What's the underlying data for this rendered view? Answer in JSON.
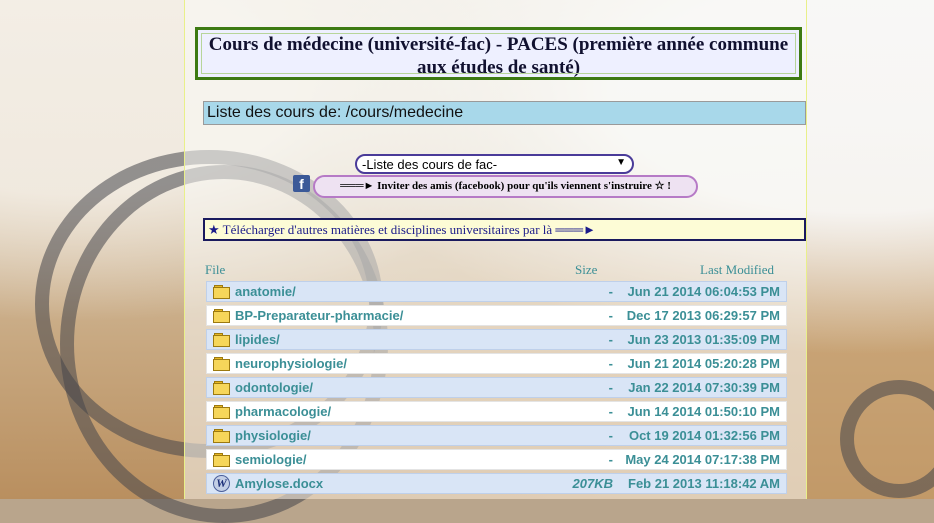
{
  "header": {
    "title": "Cours de médecine (université-fac) - PACES (première année commune aux études de santé)"
  },
  "listing": {
    "label": "Liste des cours de: /cours/medecine"
  },
  "course_select": {
    "selected": "-Liste des cours de fac-"
  },
  "invite": {
    "label": "═══► Inviter des amis (facebook) pour qu'ils viennent s'instruire ☆ !"
  },
  "download_bar": {
    "label": "★ Télécharger d'autres matières et disciplines universitaires par là ═══►"
  },
  "table": {
    "columns": {
      "file": "File",
      "size": "Size",
      "modified": "Last Modified"
    },
    "rows": [
      {
        "icon": "folder-icon",
        "name": "anatomie/",
        "size": "-",
        "modified": "Jun 21 2014 06:04:53 PM"
      },
      {
        "icon": "folder-icon",
        "name": "BP-Preparateur-pharmacie/",
        "size": "-",
        "modified": "Dec 17 2013 06:29:57 PM"
      },
      {
        "icon": "folder-icon",
        "name": "lipides/",
        "size": "-",
        "modified": "Jun 23 2013 01:35:09 PM"
      },
      {
        "icon": "folder-icon",
        "name": "neurophysiologie/",
        "size": "-",
        "modified": "Jun 21 2014 05:20:28 PM"
      },
      {
        "icon": "folder-icon",
        "name": "odontologie/",
        "size": "-",
        "modified": "Jan 22 2014 07:30:39 PM"
      },
      {
        "icon": "folder-icon",
        "name": "pharmacologie/",
        "size": "-",
        "modified": "Jun 14 2014 01:50:10 PM"
      },
      {
        "icon": "folder-icon",
        "name": "physiologie/",
        "size": "-",
        "modified": "Oct 19 2014 01:32:56 PM"
      },
      {
        "icon": "folder-icon",
        "name": "semiologie/",
        "size": "-",
        "modified": "May 24 2014 07:17:38 PM"
      },
      {
        "icon": "word-doc-icon",
        "name": "Amylose.docx",
        "size": "207KB",
        "modified": "Feb 21 2013 11:18:42 AM"
      }
    ]
  }
}
